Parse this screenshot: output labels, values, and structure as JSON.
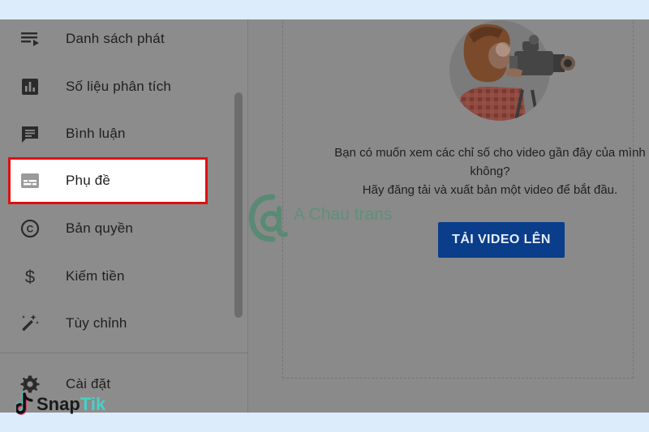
{
  "sidebar": {
    "items": [
      {
        "label": "Danh sách phát",
        "icon": "playlist-icon"
      },
      {
        "label": "Số liệu phân tích",
        "icon": "analytics-icon"
      },
      {
        "label": "Bình luận",
        "icon": "comment-icon"
      },
      {
        "label": "Phụ đề",
        "icon": "subtitles-icon",
        "active": true
      },
      {
        "label": "Bản quyền",
        "icon": "copyright-icon"
      },
      {
        "label": "Kiếm tiền",
        "icon": "dollar-icon"
      },
      {
        "label": "Tùy chỉnh",
        "icon": "magic-wand-icon"
      },
      {
        "label": "Cài đặt",
        "icon": "gear-icon"
      }
    ]
  },
  "main": {
    "message_line1": "Bạn có muốn xem các chỉ số cho video gần đây của mình",
    "message_line2": "không?",
    "message_line3": "Hãy đăng tải và xuất bản một video để bắt đầu.",
    "upload_button": "TẢI VIDEO LÊN"
  },
  "watermark": {
    "brand": "A Chau trans"
  },
  "badge": {
    "snap": "Snap",
    "tik": "Tik"
  },
  "colors": {
    "highlight_border": "#e01010",
    "button": "#0a3d8a",
    "tik_accent": "#45d2c9"
  }
}
